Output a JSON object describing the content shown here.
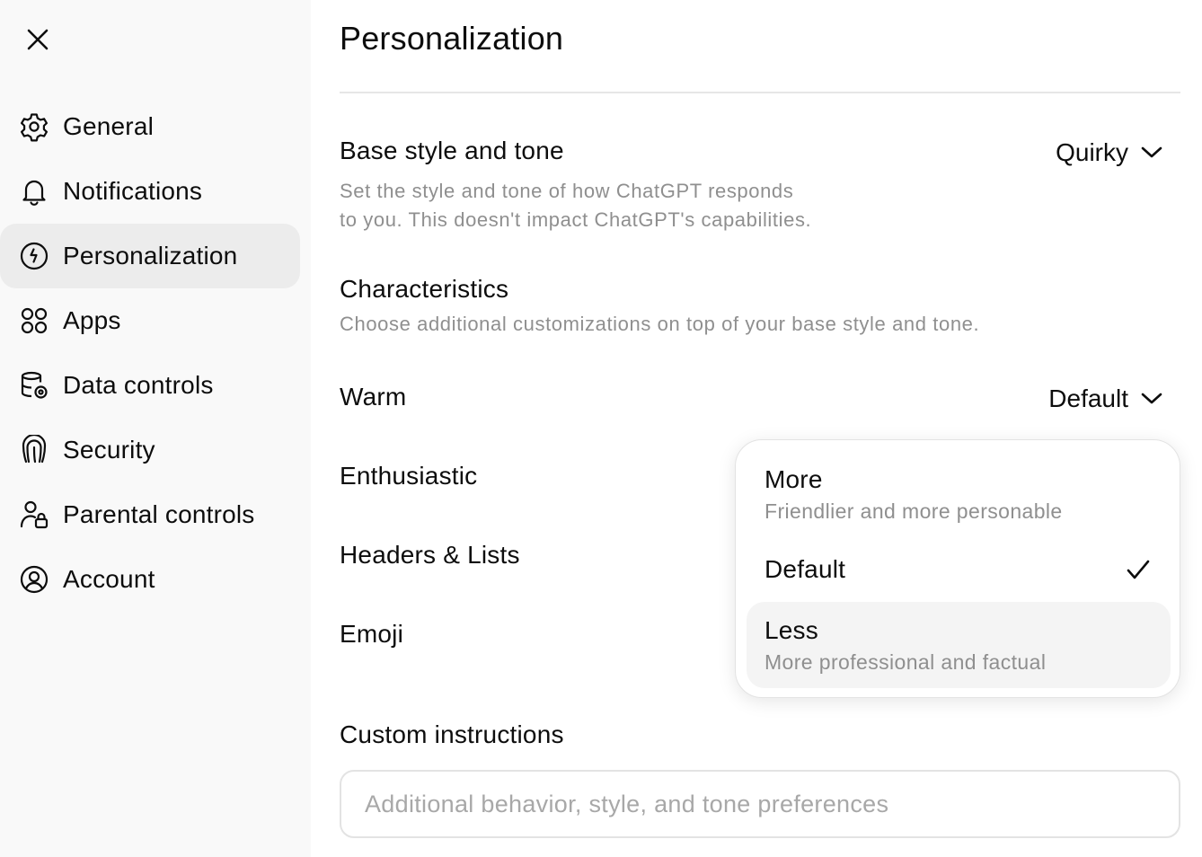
{
  "sidebar": {
    "items": [
      {
        "label": "General",
        "icon": "gear-icon"
      },
      {
        "label": "Notifications",
        "icon": "bell-icon"
      },
      {
        "label": "Personalization",
        "icon": "personalization-icon",
        "active": true
      },
      {
        "label": "Apps",
        "icon": "apps-grid-icon"
      },
      {
        "label": "Data controls",
        "icon": "database-gear-icon"
      },
      {
        "label": "Security",
        "icon": "fingerprint-icon"
      },
      {
        "label": "Parental controls",
        "icon": "person-lock-icon"
      },
      {
        "label": "Account",
        "icon": "user-circle-icon"
      }
    ]
  },
  "main": {
    "title": "Personalization",
    "base_style": {
      "label": "Base style and tone",
      "description_line1": "Set the style and tone of how ChatGPT responds",
      "description_line2": "to you. This doesn't impact ChatGPT's capabilities.",
      "value": "Quirky"
    },
    "characteristics": {
      "label": "Characteristics",
      "description": "Choose additional customizations on top of your base style and tone."
    },
    "warm": {
      "label": "Warm",
      "value": "Default"
    },
    "enthusiastic": {
      "label": "Enthusiastic"
    },
    "headers_lists": {
      "label": "Headers & Lists"
    },
    "emoji": {
      "label": "Emoji"
    },
    "custom_instructions": {
      "label": "Custom instructions",
      "placeholder": "Additional behavior, style, and tone preferences"
    }
  },
  "dropdown": {
    "options": [
      {
        "title": "More",
        "subtitle": "Friendlier and more personable"
      },
      {
        "title": "Default",
        "subtitle": "",
        "selected": true
      },
      {
        "title": "Less",
        "subtitle": "More professional and factual",
        "hovered": true
      }
    ]
  },
  "colors": {
    "sidebar_bg": "#f9f9f9",
    "active_item_bg": "#ececec",
    "muted_text": "#8f8f8f",
    "text": "#0d0d0d"
  }
}
